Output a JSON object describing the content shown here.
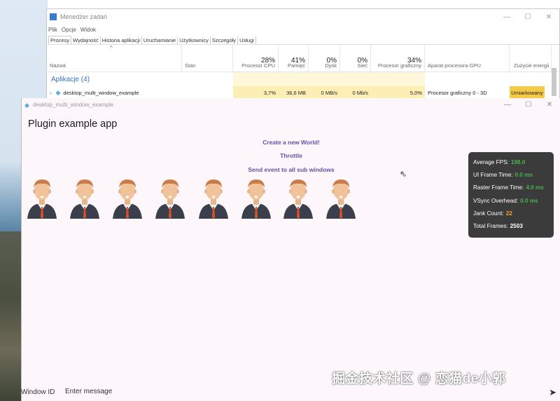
{
  "task_manager": {
    "title": "Menedżer zadań",
    "controls": [
      "—",
      "☐",
      "✕"
    ],
    "menu": [
      "Plik",
      "Opcje",
      "Widok"
    ],
    "tabs": [
      "Procesy",
      "Wydajność",
      "Historia aplikacji",
      "Uruchamianie",
      "Użytkownicy",
      "Szczegóły",
      "Usługi"
    ],
    "sort_arrow": "^",
    "columns": [
      {
        "label": "Nazwa",
        "pct": ""
      },
      {
        "label": "Stan",
        "pct": ""
      },
      {
        "label": "Procesor CPU",
        "pct": "28%"
      },
      {
        "label": "Pamięć",
        "pct": "41%"
      },
      {
        "label": "Dysk",
        "pct": "0%"
      },
      {
        "label": "Sieć",
        "pct": "0%"
      },
      {
        "label": "Procesor graficzny",
        "pct": "34%"
      },
      {
        "label": "Aparat procesora GPU",
        "pct": ""
      },
      {
        "label": "Zużycie energii",
        "pct": ""
      }
    ],
    "group": "Aplikacje (4)",
    "row": {
      "expand": "›",
      "name": "desktop_multi_window_example",
      "cpu": "3,7%",
      "memory": "36,6 MB",
      "disk": "0 MB/s",
      "network": "0 Mb/s",
      "gpu": "5,0%",
      "gpu_engine": "Procesor graficzny 0 - 3D",
      "power": "Umiarkowany"
    }
  },
  "app": {
    "window_title": "desktop_multi_window_example",
    "controls": [
      "—",
      "☐",
      "✕"
    ],
    "page_title": "Plugin example app",
    "actions": [
      "Create a new World!",
      "Throttle",
      "Send event to all sub windows"
    ],
    "avatar_count": 8,
    "perf": {
      "fps_label": "Average FPS:",
      "fps": "198.0",
      "ui_label": "UI Frame Time:",
      "ui": "0.0 ms",
      "raster_label": "Raster Frame Time:",
      "raster": "4.0 ms",
      "vsync_label": "VSync Overhead:",
      "vsync": "0.0 ms",
      "jank_label": "Jank Count:",
      "jank": "22",
      "frames_label": "Total Frames:",
      "frames": "2503"
    },
    "window_id_label": "Window ID",
    "message_placeholder": "Enter message",
    "send_icon": "➤"
  },
  "watermark": "掘金技术社区 @ 恋猫de小郭",
  "colors": {
    "accent": "#6750a4",
    "app_bg": "#fdf7fc",
    "cpu_highlight": "#fcefb4",
    "power_badge": "#f7c948",
    "perf_green": "#4caf50",
    "perf_orange": "#f5a623"
  }
}
